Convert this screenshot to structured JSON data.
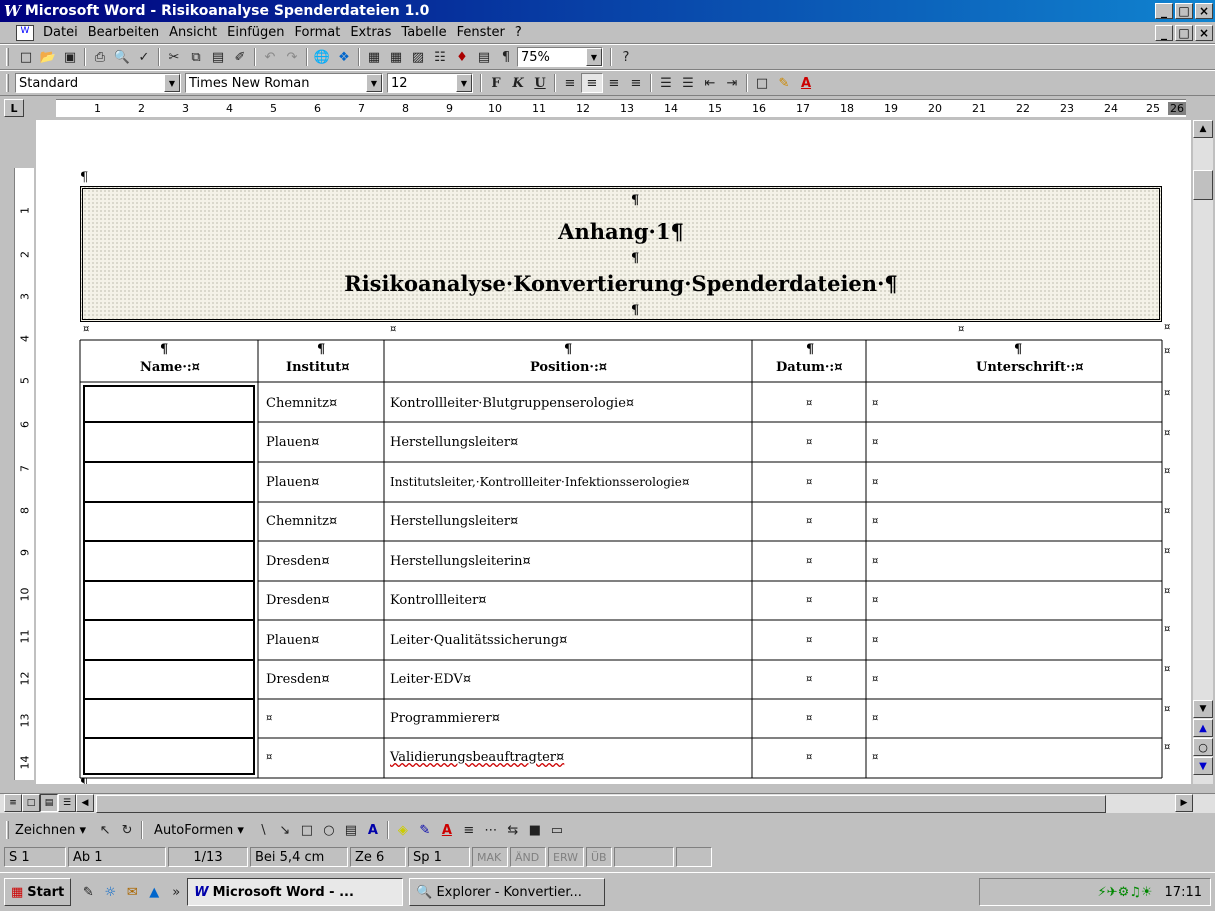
{
  "window": {
    "title": "Microsoft Word - Risikoanalyse Spenderdateien 1.0",
    "min": "_",
    "max": "□",
    "close": "×"
  },
  "menu": {
    "items": [
      "Datei",
      "Bearbeiten",
      "Ansicht",
      "Einfügen",
      "Format",
      "Extras",
      "Tabelle",
      "Fenster",
      "?"
    ]
  },
  "toolbar": {
    "zoom": "75%"
  },
  "format_bar": {
    "style": "Standard",
    "font": "Times New Roman",
    "size": "12",
    "bold": "F",
    "italic": "K",
    "underline": "U"
  },
  "ruler": {
    "ticks": [
      "1",
      "2",
      "3",
      "4",
      "5",
      "6",
      "7",
      "8",
      "9",
      "10",
      "11",
      "12",
      "13",
      "14",
      "15",
      "16",
      "17",
      "18",
      "19",
      "20",
      "21",
      "22",
      "23",
      "24",
      "25",
      "26"
    ],
    "vticks": [
      "1",
      "2",
      "3",
      "4",
      "5",
      "6",
      "7",
      "8",
      "9",
      "10",
      "11",
      "12",
      "13",
      "14"
    ]
  },
  "document": {
    "heading1": "Anhang·1¶",
    "heading2": "Risikoanalyse·Konvertierung·Spenderdateien·¶",
    "pilcrow": "¶",
    "cell_mark": "¤",
    "headers": {
      "name": "Name·:¤",
      "institut": "Institut¤",
      "position": "Position·:¤",
      "datum": "Datum·:¤",
      "unterschrift": "Unterschrift·:¤"
    },
    "rows": [
      {
        "institut": "Chemnitz¤",
        "position": "Kontrollleiter·Blutgruppenserologie¤"
      },
      {
        "institut": "Plauen¤",
        "position": "Herstellungsleiter¤"
      },
      {
        "institut": "Plauen¤",
        "position": "Institutsleiter,·Kontrollleiter·Infektionsserologie¤"
      },
      {
        "institut": "Chemnitz¤",
        "position": "Herstellungsleiter¤"
      },
      {
        "institut": "Dresden¤",
        "position": "Herstellungsleiterin¤"
      },
      {
        "institut": "Dresden¤",
        "position": "Kontrollleiter¤"
      },
      {
        "institut": "Plauen¤",
        "position": "Leiter·Qualitätssicherung¤"
      },
      {
        "institut": "Dresden¤",
        "position": "Leiter·EDV¤"
      },
      {
        "institut": "¤",
        "position": "Programmierer¤"
      },
      {
        "institut": "¤",
        "position": "Validierungsbeauftragter¤"
      }
    ]
  },
  "drawing": {
    "zeichnen": "Zeichnen ▾",
    "autoformen": "AutoFormen ▾"
  },
  "status": {
    "page": "S 1",
    "section": "Ab 1",
    "count": "1/13",
    "pos": "Bei 5,4 cm",
    "line": "Ze 6",
    "col": "Sp 1",
    "mak": "MAK",
    "and": "ÄND",
    "erw": "ERW",
    "ub": "ÜB"
  },
  "taskbar": {
    "start": "Start",
    "word": "Microsoft Word - ...",
    "explorer": "Explorer - Konvertier...",
    "clock": "17:11"
  }
}
